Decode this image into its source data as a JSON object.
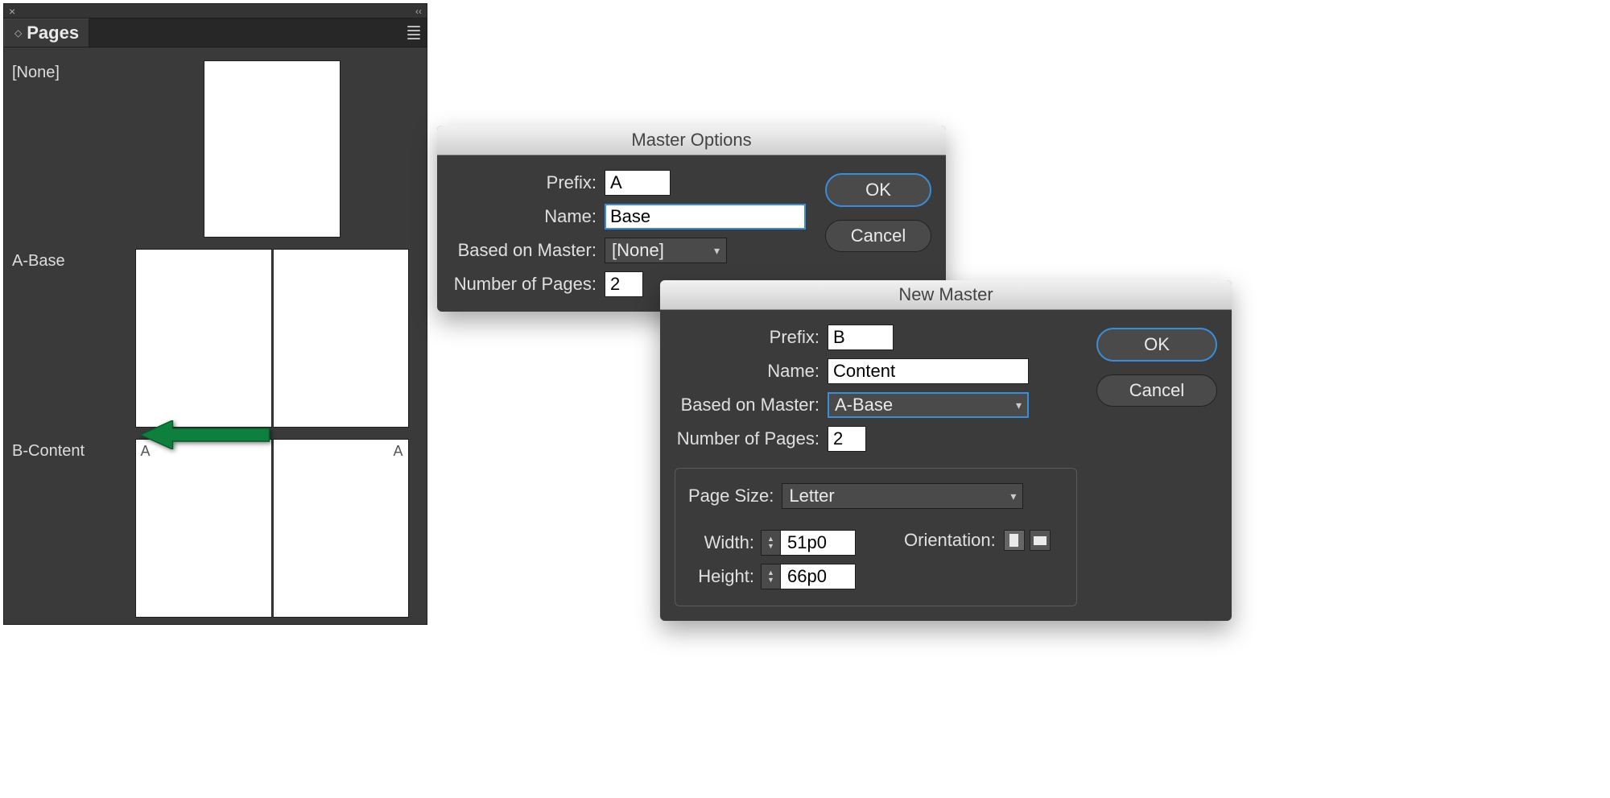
{
  "panel": {
    "title": "Pages",
    "masters": [
      {
        "label": "[None]",
        "type": "single",
        "badges": []
      },
      {
        "label": "A-Base",
        "type": "spread",
        "badges": []
      },
      {
        "label": "B-Content",
        "type": "spread",
        "badges": [
          "A",
          "A"
        ]
      }
    ]
  },
  "dialog1": {
    "title": "Master Options",
    "fields": {
      "prefix_label": "Prefix:",
      "prefix_value": "A",
      "name_label": "Name:",
      "name_value": "Base",
      "based_on_label": "Based on Master:",
      "based_on_value": "[None]",
      "num_pages_label": "Number of Pages:",
      "num_pages_value": "2"
    },
    "buttons": {
      "ok": "OK",
      "cancel": "Cancel"
    }
  },
  "dialog2": {
    "title": "New Master",
    "fields": {
      "prefix_label": "Prefix:",
      "prefix_value": "B",
      "name_label": "Name:",
      "name_value": "Content",
      "based_on_label": "Based on Master:",
      "based_on_value": "A-Base",
      "num_pages_label": "Number of Pages:",
      "num_pages_value": "2",
      "page_size_label": "Page Size:",
      "page_size_value": "Letter",
      "width_label": "Width:",
      "width_value": "51p0",
      "height_label": "Height:",
      "height_value": "66p0",
      "orientation_label": "Orientation:"
    },
    "buttons": {
      "ok": "OK",
      "cancel": "Cancel"
    }
  }
}
